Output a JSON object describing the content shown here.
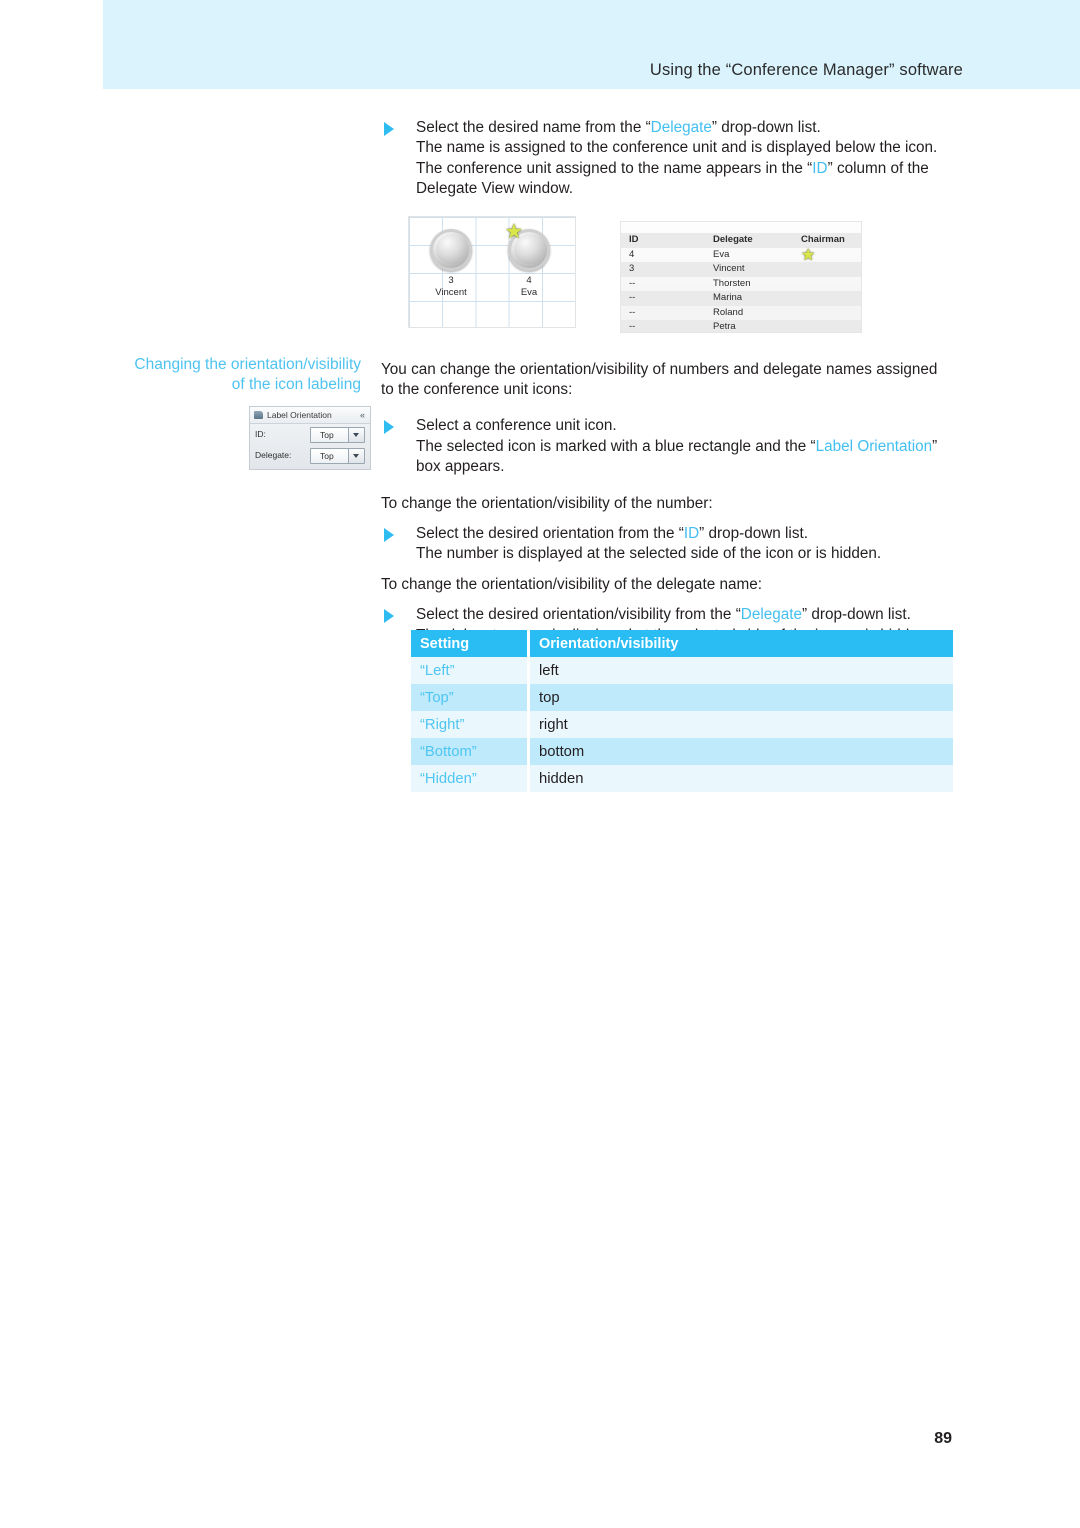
{
  "header": {
    "running_title": "Using the “Conference Manager” software",
    "band_color": "#daf3fd"
  },
  "page_number": "89",
  "accent_color": "#43bff0",
  "steps_top": {
    "bullet1": {
      "line1_a": "Select the desired name from the “",
      "line1_link": "Delegate",
      "line1_b": "” drop-down list.",
      "line2": "The name is assigned to the conference unit and is displayed below the icon.",
      "line3_a": "The conference unit assigned to the name appears in the “",
      "line3_link": "ID",
      "line3_b": "” column of the",
      "line4": "Delegate View window."
    }
  },
  "figure_icons": {
    "units": [
      {
        "number": "3",
        "name": "Vincent",
        "chairman": false
      },
      {
        "number": "4",
        "name": "Eva",
        "chairman": true
      }
    ],
    "star_glyph": "★"
  },
  "figure_table": {
    "columns": [
      "ID",
      "Delegate",
      "Chairman"
    ],
    "rows": [
      {
        "id": "4",
        "delegate": "Eva",
        "chairman": "★"
      },
      {
        "id": "3",
        "delegate": "Vincent",
        "chairman": ""
      },
      {
        "id": "--",
        "delegate": "Thorsten",
        "chairman": ""
      },
      {
        "id": "--",
        "delegate": "Marina",
        "chairman": ""
      },
      {
        "id": "--",
        "delegate": "Roland",
        "chairman": ""
      },
      {
        "id": "--",
        "delegate": "Petra",
        "chairman": ""
      }
    ]
  },
  "margin_heading": {
    "line1": "Changing the orientation/visibility",
    "line2": "of the icon labeling"
  },
  "dialog": {
    "title": "Label Orientation",
    "collapse_glyph": "«",
    "rows": [
      {
        "label": "ID:",
        "value": "Top"
      },
      {
        "label": "Delegate:",
        "value": "Top"
      }
    ]
  },
  "body": {
    "intro_line1": "You can change the orientation/visibility of numbers and delegate names assigned",
    "intro_line2": "to the conference unit icons:",
    "bullet_select_icon": {
      "line1": "Select a conference unit icon.",
      "line2_a": "The selected icon is marked with a blue rectangle and the “",
      "line2_link": "Label Orientation",
      "line2_b": "”",
      "line3": "box appears."
    },
    "lead_number": "To change the orientation/visibility of the number:",
    "bullet_number": {
      "line1_a": "Select the desired orientation from the “",
      "line1_link": "ID",
      "line1_b": "” drop-down list.",
      "line2": "The number is displayed at the selected side of the icon or is hidden."
    },
    "lead_delegate": "To change the orientation/visibility of the delegate name:",
    "bullet_delegate": {
      "line1_a": "Select the desired orientation/visibility from the “",
      "line1_link": "Delegate",
      "line1_b": "” drop-down list.",
      "line2": "The delegate name is displayed at the selected side of the icon or is hidden."
    }
  },
  "settings_table": {
    "headers": [
      "Setting",
      "Orientation/visibility"
    ],
    "rows": [
      {
        "setting": "“Left”",
        "value": "left"
      },
      {
        "setting": "“Top”",
        "value": "top"
      },
      {
        "setting": "“Right”",
        "value": "right"
      },
      {
        "setting": "“Bottom”",
        "value": "bottom"
      },
      {
        "setting": "“Hidden”",
        "value": "hidden"
      }
    ]
  }
}
